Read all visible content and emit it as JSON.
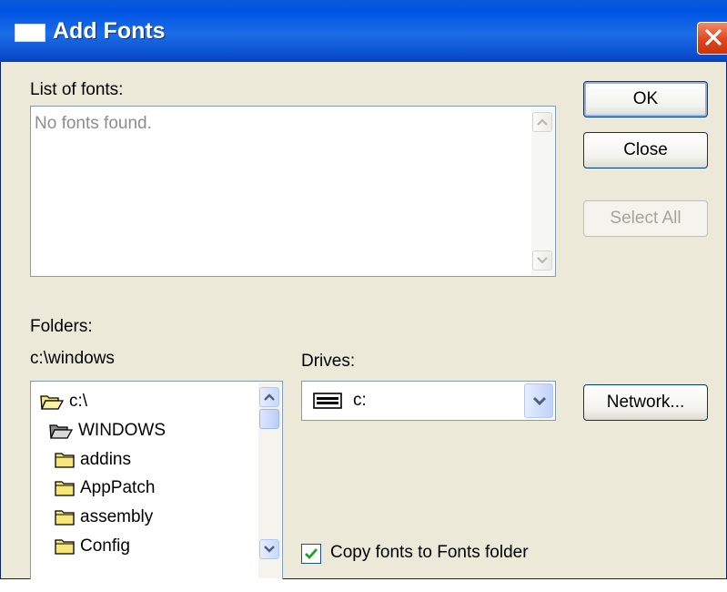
{
  "window": {
    "title": "Add Fonts"
  },
  "fonts_list": {
    "label": "List of fonts:",
    "empty_text": "No fonts found."
  },
  "buttons": {
    "ok": "OK",
    "close": "Close",
    "select_all": "Select All",
    "network": "Network..."
  },
  "folders": {
    "label": "Folders:",
    "current_path": "c:\\windows",
    "tree": [
      {
        "name": "c:\\",
        "icon": "open-folder-icon"
      },
      {
        "name": "WINDOWS",
        "icon": "open-folder-icon"
      },
      {
        "name": "addins",
        "icon": "folder-icon"
      },
      {
        "name": "AppPatch",
        "icon": "folder-icon"
      },
      {
        "name": "assembly",
        "icon": "folder-icon"
      },
      {
        "name": "Config",
        "icon": "folder-icon"
      }
    ]
  },
  "drives": {
    "label": "Drives:",
    "selected": "c:",
    "icon": "hard-drive-icon"
  },
  "copy_option": {
    "label": "Copy fonts to Fonts folder",
    "checked": true
  },
  "colors": {
    "titlebar": "#0054e3",
    "dialog_bg": "#ece9d8",
    "close_button": "#e0441c",
    "disabled_text": "#a5a595"
  }
}
